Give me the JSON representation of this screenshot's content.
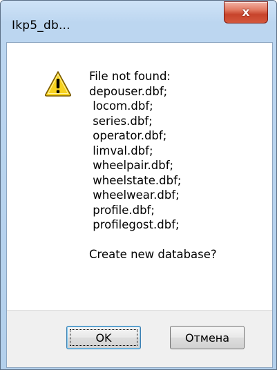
{
  "window": {
    "title": "Ikp5_db...",
    "close_label": "x"
  },
  "icon": "warning-icon",
  "message": {
    "lines": [
      "File not found:",
      "depouser.dbf;",
      " locom.dbf;",
      " series.dbf;",
      " operator.dbf;",
      " limval.dbf;",
      " wheelpair.dbf;",
      " wheelstate.dbf;",
      " wheelwear.dbf;",
      " profile.dbf;",
      " profilegost.dbf;",
      "",
      "Create new database?"
    ]
  },
  "buttons": {
    "ok_label": "OK",
    "cancel_label": "Отмена"
  },
  "colors": {
    "warning_fill": "#f7d21e",
    "warning_border": "#7a5a00",
    "close_button": "#c7432b"
  }
}
